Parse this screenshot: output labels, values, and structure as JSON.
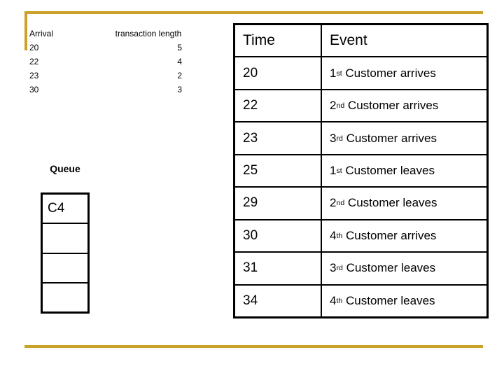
{
  "theme": {
    "accent_gold": "#c9a227",
    "line_black": "#000000",
    "background": "#ffffff"
  },
  "arrival_list": {
    "header": {
      "col1": "Arrival",
      "col2": "transaction length"
    },
    "rows": [
      {
        "arrival": "20",
        "length": "5"
      },
      {
        "arrival": "22",
        "length": "4"
      },
      {
        "arrival": "23",
        "length": "2"
      },
      {
        "arrival": "30",
        "length": "3"
      }
    ]
  },
  "queue": {
    "label": "Queue",
    "cells": [
      "C4",
      "",
      "",
      ""
    ]
  },
  "event_table": {
    "header": {
      "time": "Time",
      "event": "Event"
    },
    "rows": [
      {
        "time": "20",
        "num": "1",
        "ord": "st",
        "event": "Customer arrives"
      },
      {
        "time": "22",
        "num": "2",
        "ord": "nd",
        "event": "Customer arrives"
      },
      {
        "time": "23",
        "num": "3",
        "ord": "rd",
        "event": "Customer arrives"
      },
      {
        "time": "25",
        "num": "1",
        "ord": "st",
        "event": "Customer leaves"
      },
      {
        "time": "29",
        "num": "2",
        "ord": "nd",
        "event": "Customer leaves"
      },
      {
        "time": "30",
        "num": "4",
        "ord": "th",
        "event": "Customer arrives"
      },
      {
        "time": "31",
        "num": "3",
        "ord": "rd",
        "event": "Customer leaves"
      },
      {
        "time": "34",
        "num": "4",
        "ord": "th",
        "event": "Customer leaves"
      }
    ]
  }
}
